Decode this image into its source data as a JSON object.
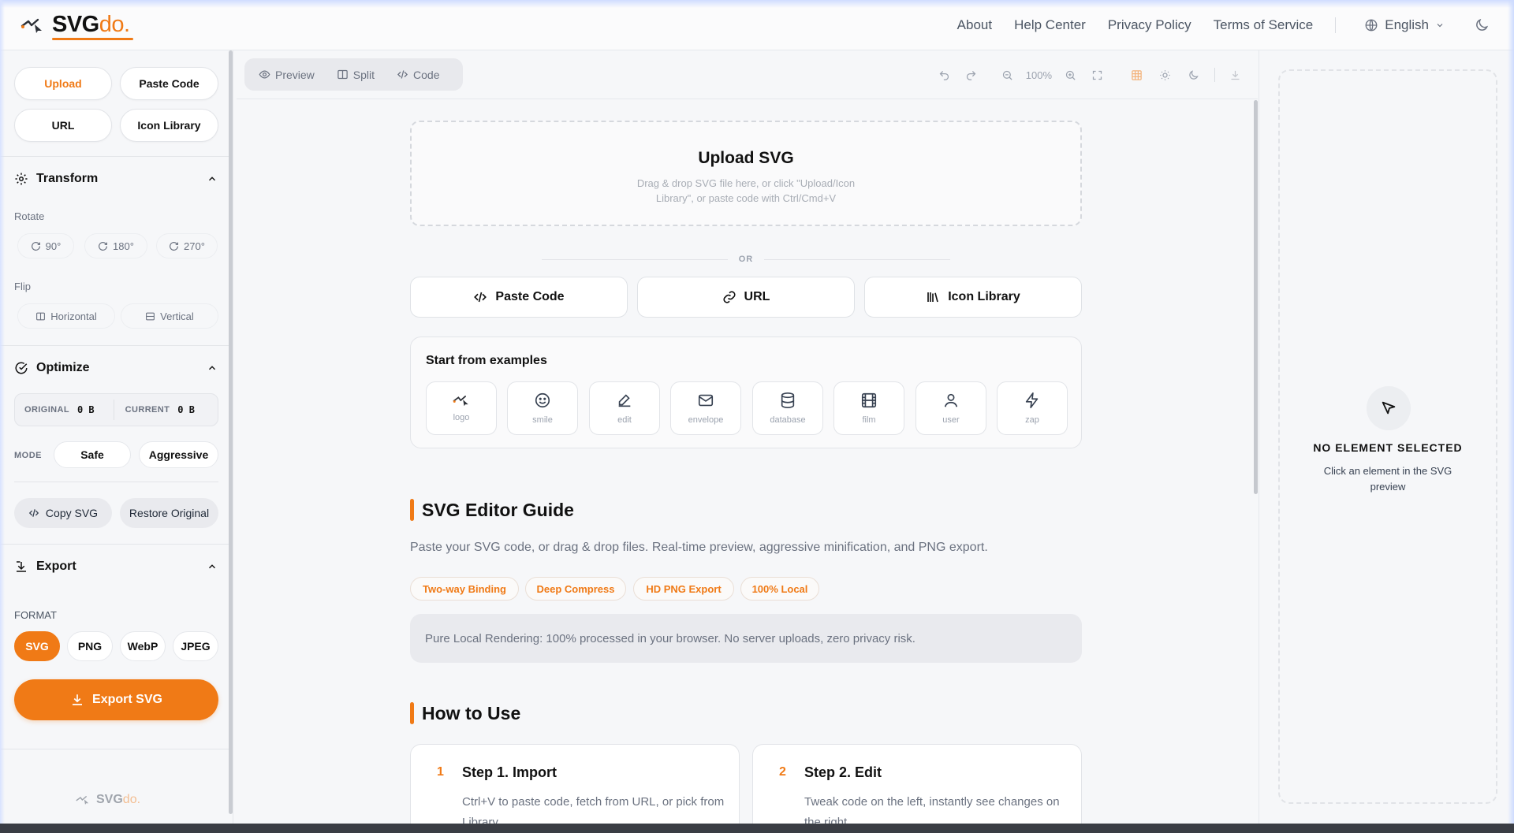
{
  "header": {
    "logo_main": "SVG",
    "logo_accent": "do.",
    "nav": [
      "About",
      "Help Center",
      "Privacy Policy",
      "Terms of Service"
    ],
    "language": "English"
  },
  "left": {
    "source_buttons": [
      "Upload",
      "Paste Code",
      "URL",
      "Icon Library"
    ],
    "transform": {
      "title": "Transform",
      "rotate_label": "Rotate",
      "rotate_options": [
        "90°",
        "180°",
        "270°"
      ],
      "flip_label": "Flip",
      "flip_options": [
        "Horizontal",
        "Vertical"
      ]
    },
    "optimize": {
      "title": "Optimize",
      "original_label": "ORIGINAL",
      "original_value": "0 B",
      "current_label": "CURRENT",
      "current_value": "0 B",
      "mode_label": "MODE",
      "modes": [
        "Safe",
        "Aggressive"
      ],
      "copy_label": "Copy SVG",
      "restore_label": "Restore Original"
    },
    "export": {
      "title": "Export",
      "format_label": "FORMAT",
      "formats": [
        "SVG",
        "PNG",
        "WebP",
        "JPEG"
      ],
      "selected_format": "SVG",
      "export_label": "Export SVG"
    },
    "footer_logo_main": "SVG",
    "footer_logo_accent": "do."
  },
  "toolbar": {
    "tabs": [
      "Preview",
      "Split",
      "Code"
    ],
    "zoom": "100%"
  },
  "main": {
    "upload_title": "Upload SVG",
    "upload_hint": "Drag & drop SVG file here, or click \"Upload/Icon Library\", or paste code with Ctrl/Cmd+V",
    "or_text": "OR",
    "source_buttons": [
      "Paste Code",
      "URL",
      "Icon Library"
    ],
    "examples_title": "Start from examples",
    "examples": [
      "logo",
      "smile",
      "edit",
      "envelope",
      "database",
      "film",
      "user",
      "zap"
    ],
    "guide_title": "SVG Editor Guide",
    "guide_desc": "Paste your SVG code, or drag & drop files. Real-time preview, aggressive minification, and PNG export.",
    "tags": [
      "Two-way Binding",
      "Deep Compress",
      "HD PNG Export",
      "100% Local"
    ],
    "notice": "Pure Local Rendering: 100% processed in your browser. No server uploads, zero privacy risk.",
    "how_title": "How to Use",
    "steps": [
      {
        "num": "1",
        "title": "Step 1. Import",
        "desc": "Ctrl+V to paste code, fetch from URL, or pick from Library"
      },
      {
        "num": "2",
        "title": "Step 2. Edit",
        "desc": "Tweak code on the left, instantly see changes on the right"
      }
    ]
  },
  "inspector": {
    "title": "NO ELEMENT SELECTED",
    "desc": "Click an element in the SVG preview"
  },
  "colors": {
    "accent": "#f07a16",
    "background": "#f6f7f9"
  }
}
